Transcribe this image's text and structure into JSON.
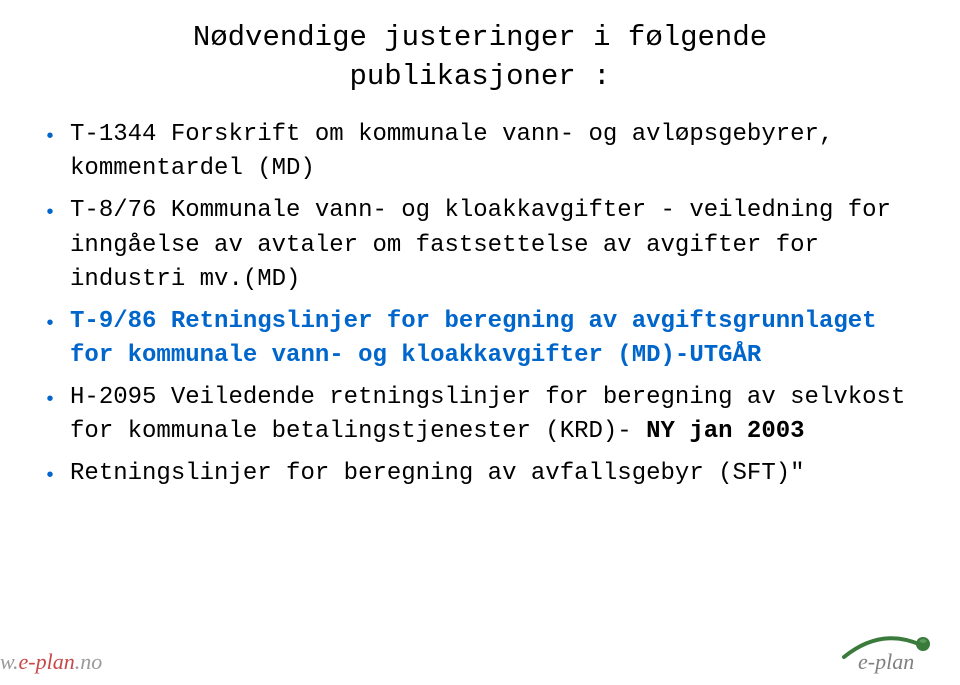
{
  "title_line1": "Nødvendige justeringer i følgende",
  "title_line2": "publikasjoner :",
  "items": [
    {
      "parts": [
        {
          "text": "T-1344 Forskrift om kommunale vann- og avløpsgebyrer, kommentardel (MD)",
          "style": "normal"
        }
      ]
    },
    {
      "parts": [
        {
          "text": "T-8/76 Kommunale vann- og kloakkavgifter - veiledning for inngåelse av avtaler om fastsettelse av avgifter for industri mv.(MD)",
          "style": "normal"
        }
      ]
    },
    {
      "parts": [
        {
          "text": "T-9/86 Retningslinjer for beregning av avgiftsgrunnlaget for kommunale vann- og kloakkavgifter (MD)-UTGÅR",
          "style": "blue-bold"
        }
      ]
    },
    {
      "parts": [
        {
          "text": "H-2095 Veiledende retningslinjer for beregning av selvkost for kommunale betalingstjenester (KRD)- ",
          "style": "normal"
        },
        {
          "text": "NY jan 2003",
          "style": "bold"
        }
      ]
    },
    {
      "parts": [
        {
          "text": "Retningslinjer for beregning av avfallsgebyr (SFT)\"",
          "style": "normal"
        }
      ]
    }
  ],
  "footer": {
    "left_prefix": "w.",
    "left_red": "e-plan",
    "left_suffix": ".no",
    "logo_text": "e-plan"
  }
}
